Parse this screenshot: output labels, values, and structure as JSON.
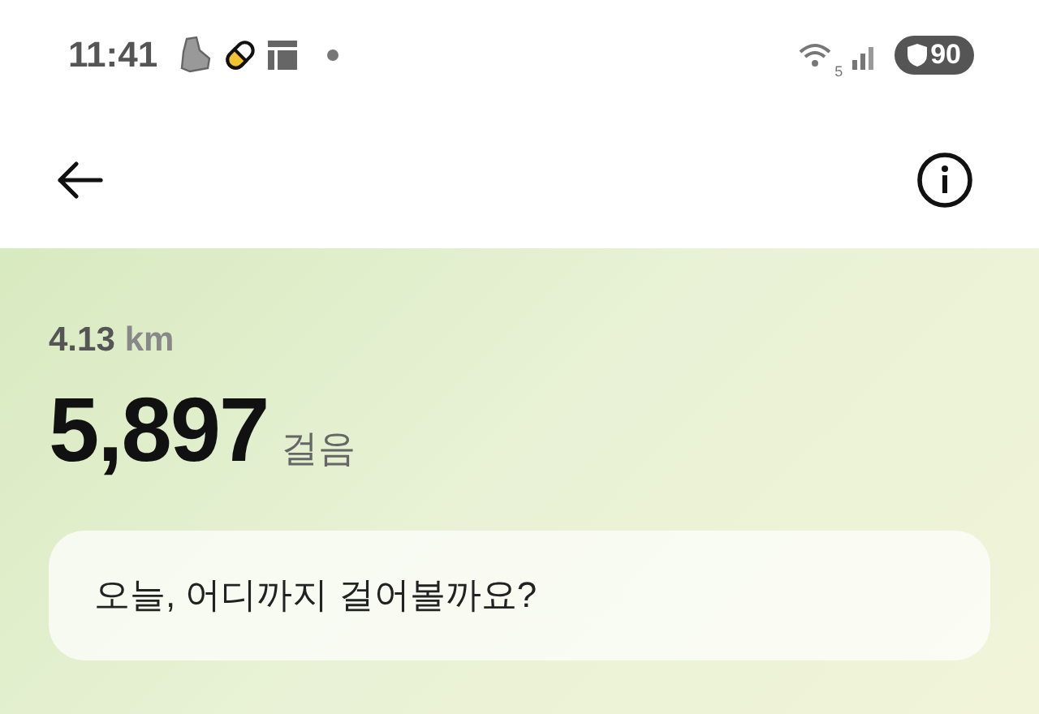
{
  "status_bar": {
    "time": "11:41",
    "network_label": "5",
    "battery": "90"
  },
  "stats": {
    "distance": "4.13",
    "distance_unit": "km",
    "steps": "5,897",
    "steps_unit": "걸음"
  },
  "prompt_card": {
    "text": "오늘, 어디까지 걸어볼까요?"
  }
}
